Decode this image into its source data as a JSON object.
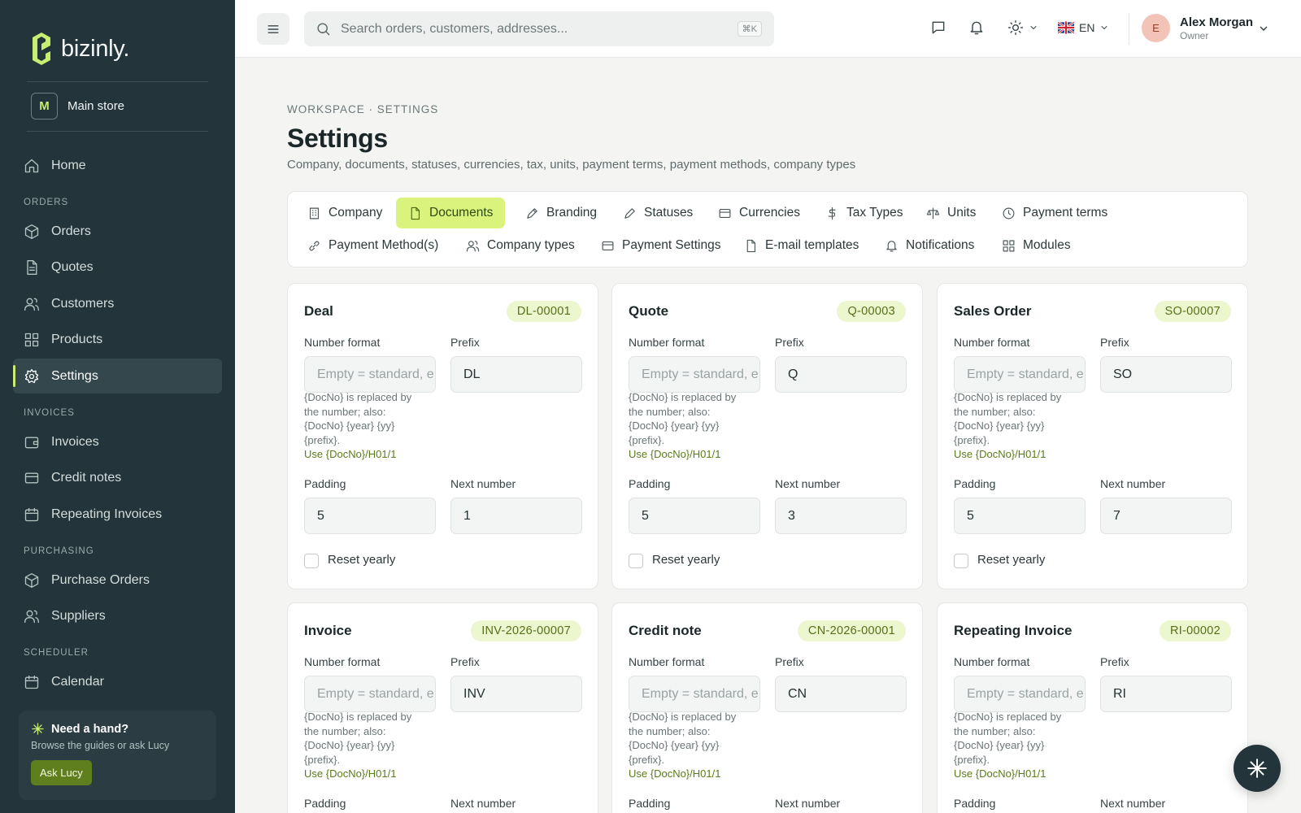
{
  "brand": {
    "name": "bizinly.",
    "accent": "#c9ec72"
  },
  "store": {
    "initial": "M",
    "name": "Main store"
  },
  "sidebar": {
    "home": "Home",
    "sections": [
      "ORDERS",
      "INVOICES",
      "PURCHASING",
      "SCHEDULER"
    ],
    "orders": [
      "Orders",
      "Quotes",
      "Customers",
      "Products",
      "Settings"
    ],
    "invoices": [
      "Invoices",
      "Credit notes",
      "Repeating Invoices"
    ],
    "purchasing": [
      "Purchase Orders",
      "Suppliers"
    ],
    "scheduler": [
      "Calendar"
    ],
    "active": "Settings"
  },
  "help": {
    "title": "Need a hand?",
    "subtitle": "Browse the guides or ask Lucy",
    "button": "Ask Lucy"
  },
  "topbar": {
    "search_placeholder": "Search orders, customers, addresses...",
    "shortcut": "⌘K",
    "language": "EN",
    "user": {
      "initial": "E",
      "name": "Alex Morgan",
      "role": "Owner"
    }
  },
  "page": {
    "breadcrumb": "WORKSPACE · SETTINGS",
    "title": "Settings",
    "subtitle": "Company, documents, statuses, currencies, tax, units, payment terms, payment methods, company types"
  },
  "tabs": [
    "Company",
    "Documents",
    "Branding",
    "Statuses",
    "Currencies",
    "Tax Types",
    "Units",
    "Payment terms",
    "Payment Method(s)",
    "Company types",
    "Payment Settings",
    "E-mail templates",
    "Notifications",
    "Modules"
  ],
  "active_tab": "Documents",
  "labels": {
    "number_format": "Number format",
    "prefix": "Prefix",
    "padding": "Padding",
    "next_number": "Next number",
    "reset_yearly": "Reset yearly",
    "format_placeholder": "Empty = standard, e.g. {DocNo}",
    "hint": "{DocNo} is replaced by the number; also: {DocNo} {year} {yy} {prefix}.",
    "hint_use": "Use {DocNo}/H01/1"
  },
  "documents": [
    {
      "title": "Deal",
      "code": "DL-00001",
      "prefix": "DL",
      "padding": "5",
      "next": "1"
    },
    {
      "title": "Quote",
      "code": "Q-00003",
      "prefix": "Q",
      "padding": "5",
      "next": "3"
    },
    {
      "title": "Sales Order",
      "code": "SO-00007",
      "prefix": "SO",
      "padding": "5",
      "next": "7"
    },
    {
      "title": "Invoice",
      "code": "INV-2026-00007",
      "prefix": "INV"
    },
    {
      "title": "Credit note",
      "code": "CN-2026-00001",
      "prefix": "CN"
    },
    {
      "title": "Repeating Invoice",
      "code": "RI-00002",
      "prefix": "RI"
    }
  ]
}
